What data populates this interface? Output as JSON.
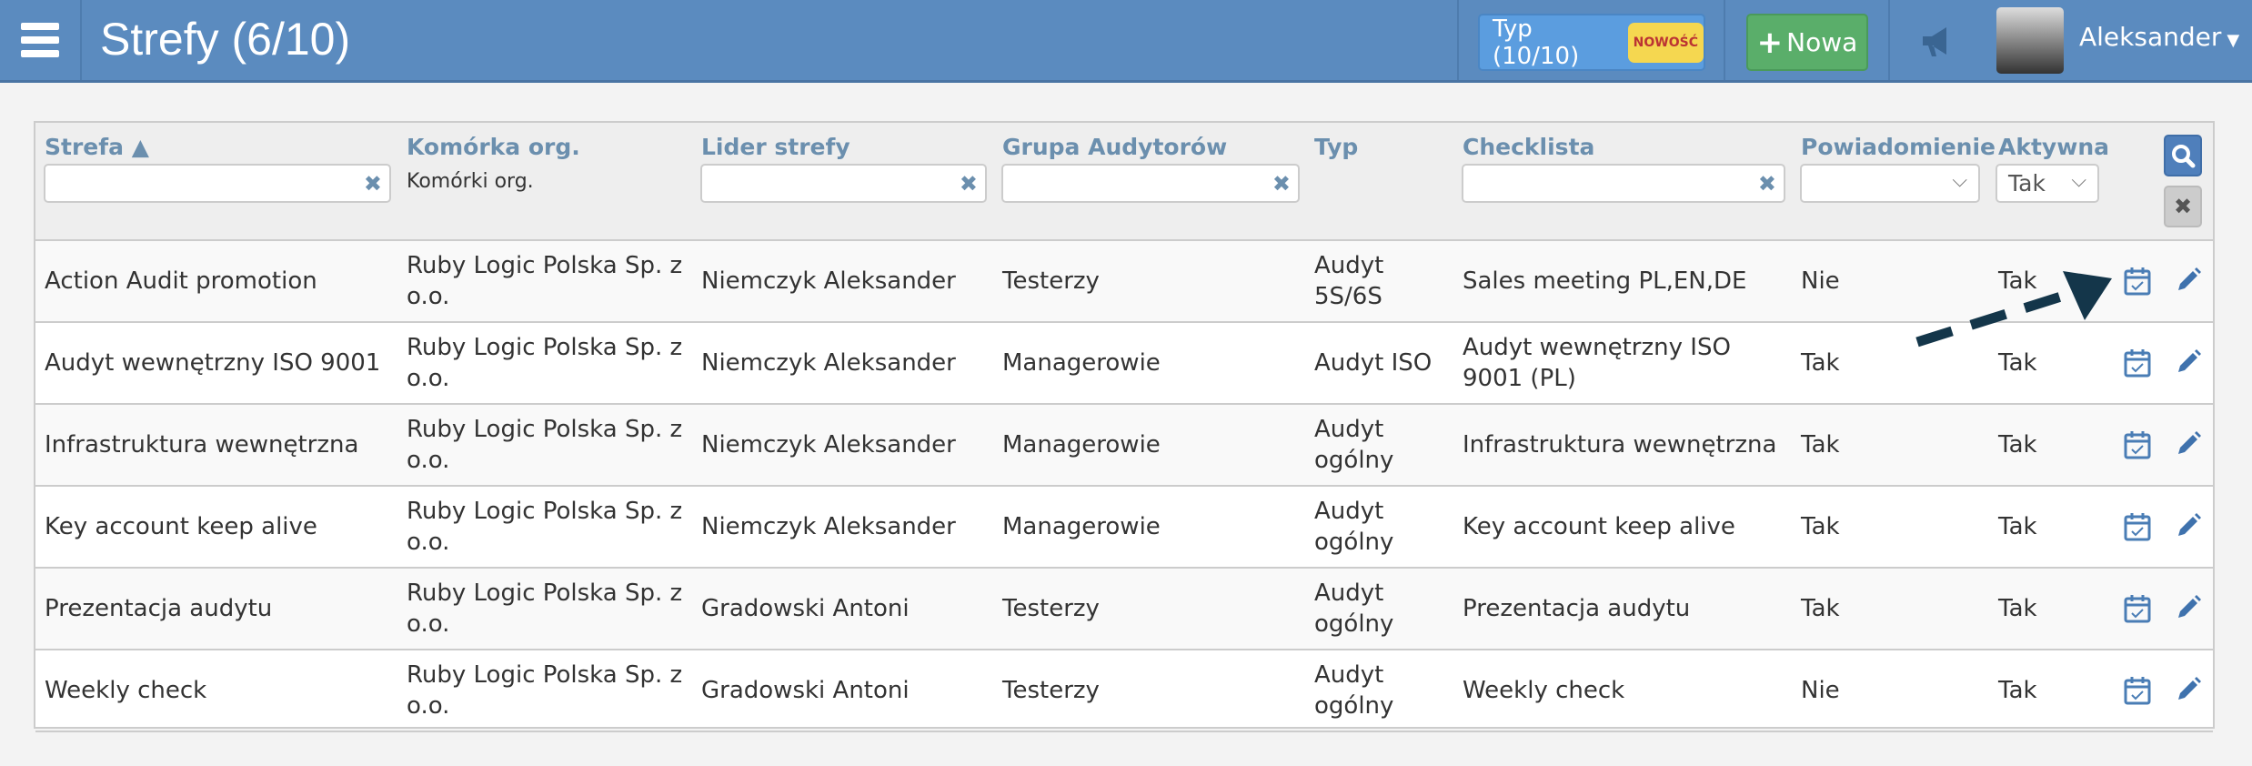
{
  "header": {
    "title": "Strefy (6/10)",
    "type_button": "Typ (10/10)",
    "type_badge": "NOWOŚĆ",
    "new_button": "Nowa",
    "user_name": "Aleksander",
    "brand_color": "#5b8bbf"
  },
  "filters": {
    "komorka_placeholder": "Komórki org.",
    "aktywna_value": "Tak",
    "powiadomienie_value": ""
  },
  "columns": [
    "Strefa ▲",
    "Komórka org.",
    "Lider strefy",
    "Grupa Audytorów",
    "Typ",
    "Checklista",
    "Powiadomienie",
    "Aktywna"
  ],
  "rows": [
    [
      "Action Audit promotion",
      "Ruby Logic Polska Sp. z o.o.",
      "Niemczyk Aleksander",
      "Testerzy",
      "Audyt 5S/6S",
      "Sales meeting PL,EN,DE",
      "Nie",
      "Tak"
    ],
    [
      "Audyt wewnętrzny ISO 9001",
      "Ruby Logic Polska Sp. z o.o.",
      "Niemczyk Aleksander",
      "Managerowie",
      "Audyt ISO",
      "Audyt wewnętrzny ISO 9001 (PL)",
      "Tak",
      "Tak"
    ],
    [
      "Infrastruktura wewnętrzna",
      "Ruby Logic Polska Sp. z o.o.",
      "Niemczyk Aleksander",
      "Managerowie",
      "Audyt ogólny",
      "Infrastruktura wewnętrzna",
      "Tak",
      "Tak"
    ],
    [
      "Key account keep alive",
      "Ruby Logic Polska Sp. z o.o.",
      "Niemczyk Aleksander",
      "Managerowie",
      "Audyt ogólny",
      "Key account keep alive",
      "Tak",
      "Tak"
    ],
    [
      "Prezentacja audytu",
      "Ruby Logic Polska Sp. z o.o.",
      "Gradowski Antoni",
      "Testerzy",
      "Audyt ogólny",
      "Prezentacja audytu",
      "Tak",
      "Tak"
    ],
    [
      "Weekly check",
      "Ruby Logic Polska Sp. z o.o.",
      "Gradowski Antoni",
      "Testerzy",
      "Audyt ogólny",
      "Weekly check",
      "Nie",
      "Tak"
    ]
  ]
}
